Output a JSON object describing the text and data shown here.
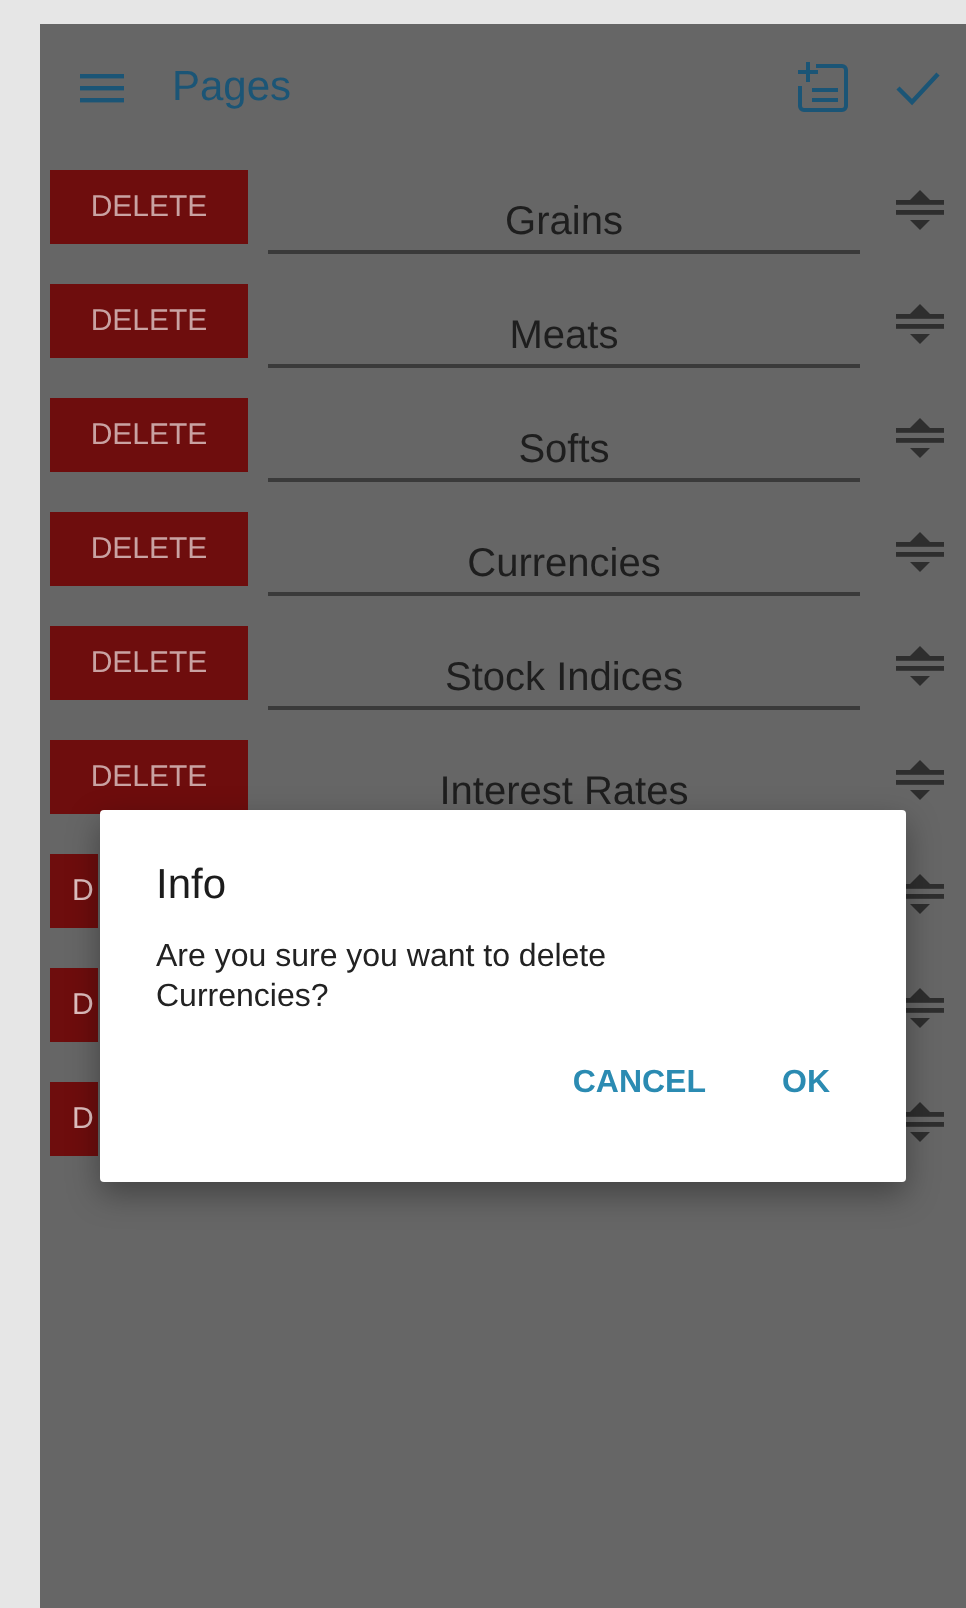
{
  "app_bar": {
    "title": "Pages"
  },
  "pages": [
    {
      "delete_label": "DELETE",
      "name": "Grains"
    },
    {
      "delete_label": "DELETE",
      "name": "Meats"
    },
    {
      "delete_label": "DELETE",
      "name": "Softs"
    },
    {
      "delete_label": "DELETE",
      "name": "Currencies"
    },
    {
      "delete_label": "DELETE",
      "name": "Stock Indices"
    },
    {
      "delete_label": "DELETE",
      "name": "Interest Rates"
    },
    {
      "delete_label": "D"
    },
    {
      "delete_label": "D"
    },
    {
      "delete_label": "D"
    }
  ],
  "dialog": {
    "title": "Info",
    "message": "Are you sure you want to delete Currencies?",
    "buttons": [
      "CANCEL",
      "OK"
    ]
  }
}
